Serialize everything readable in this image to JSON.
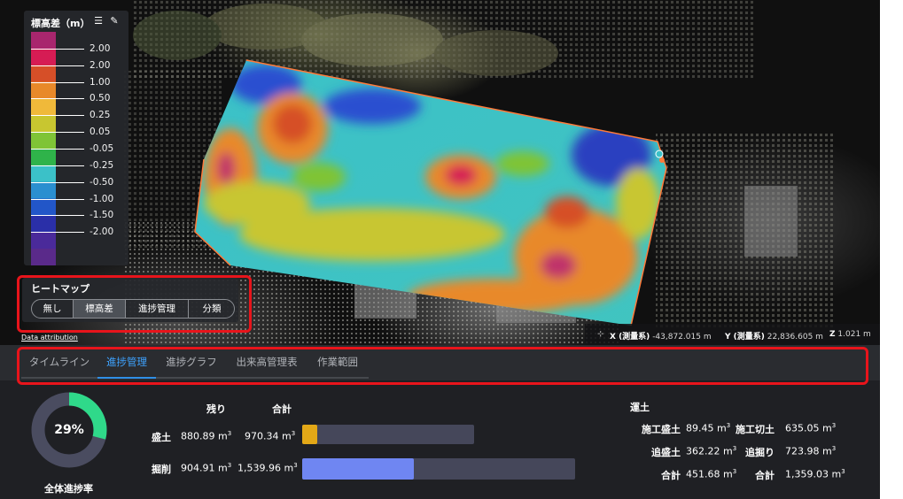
{
  "legend": {
    "title": "標高差（m）",
    "entries": [
      {
        "label": "2.00",
        "color": "#d61c54"
      },
      {
        "label": "2.00",
        "color": "#d64f28"
      },
      {
        "label": "1.00",
        "color": "#e8892a"
      },
      {
        "label": "0.50",
        "color": "#f0b93a"
      },
      {
        "label": "0.25",
        "color": "#c8c630"
      },
      {
        "label": "0.05",
        "color": "#7fc436"
      },
      {
        "label": "-0.05",
        "color": "#2fb34a"
      },
      {
        "label": "-0.25",
        "color": "#3bc1c8"
      },
      {
        "label": "-0.50",
        "color": "#2a8fd0"
      },
      {
        "label": "-1.00",
        "color": "#2256c8"
      },
      {
        "label": "-1.50",
        "color": "#2a2fa8"
      },
      {
        "label": "-2.00",
        "color": "#4a2a9a"
      }
    ],
    "top_color": "#a8266e",
    "bottom_color": "#5a2a8a"
  },
  "heatmap": {
    "title": "ヒートマップ",
    "options": [
      "無し",
      "標高差",
      "進捗管理",
      "分類"
    ],
    "selected": "標高差"
  },
  "viewport": {
    "attribution": "Data attribution",
    "coord_x_label": "X (測量系)",
    "coord_x_value": "-43,872.015 m",
    "coord_y_label": "Y (測量系)",
    "coord_y_value": "22,836.605 m",
    "coord_z_label": "Z",
    "coord_z_value": "1.021 m"
  },
  "tabs": [
    {
      "label": "タイムライン",
      "active": false
    },
    {
      "label": "進捗管理",
      "active": true
    },
    {
      "label": "進捗グラフ",
      "active": false
    },
    {
      "label": "出来高管理表",
      "active": false
    },
    {
      "label": "作業範囲",
      "active": false
    }
  ],
  "progress": {
    "overall_percent": "29%",
    "overall_fraction": 0.29,
    "overall_label": "全体進捗率",
    "col_remaining": "残り",
    "col_total": "合計",
    "rows": [
      {
        "name": "盛土",
        "remaining": "880.89 m",
        "total": "970.34 m",
        "fraction": 0.09,
        "color": "#e3a817"
      },
      {
        "name": "掘削",
        "remaining": "904.91 m",
        "total": "1,539.96 m",
        "fraction": 0.41,
        "color": "#6f86f2"
      }
    ],
    "ring_done_color": "#2fd98a",
    "ring_rest_color": "#4a4c60"
  },
  "earthwork": {
    "title": "運土",
    "rows": [
      {
        "l1": "施工盛土",
        "v1": "89.45 m",
        "l2": "施工切土",
        "v2": "635.05 m"
      },
      {
        "l1": "追盛土",
        "v1": "362.22 m",
        "l2": "追掘り",
        "v2": "723.98 m"
      },
      {
        "l1": "合計",
        "v1": "451.68 m",
        "l2": "合計",
        "v2": "1,359.03 m"
      }
    ],
    "unit_sup": "3"
  }
}
